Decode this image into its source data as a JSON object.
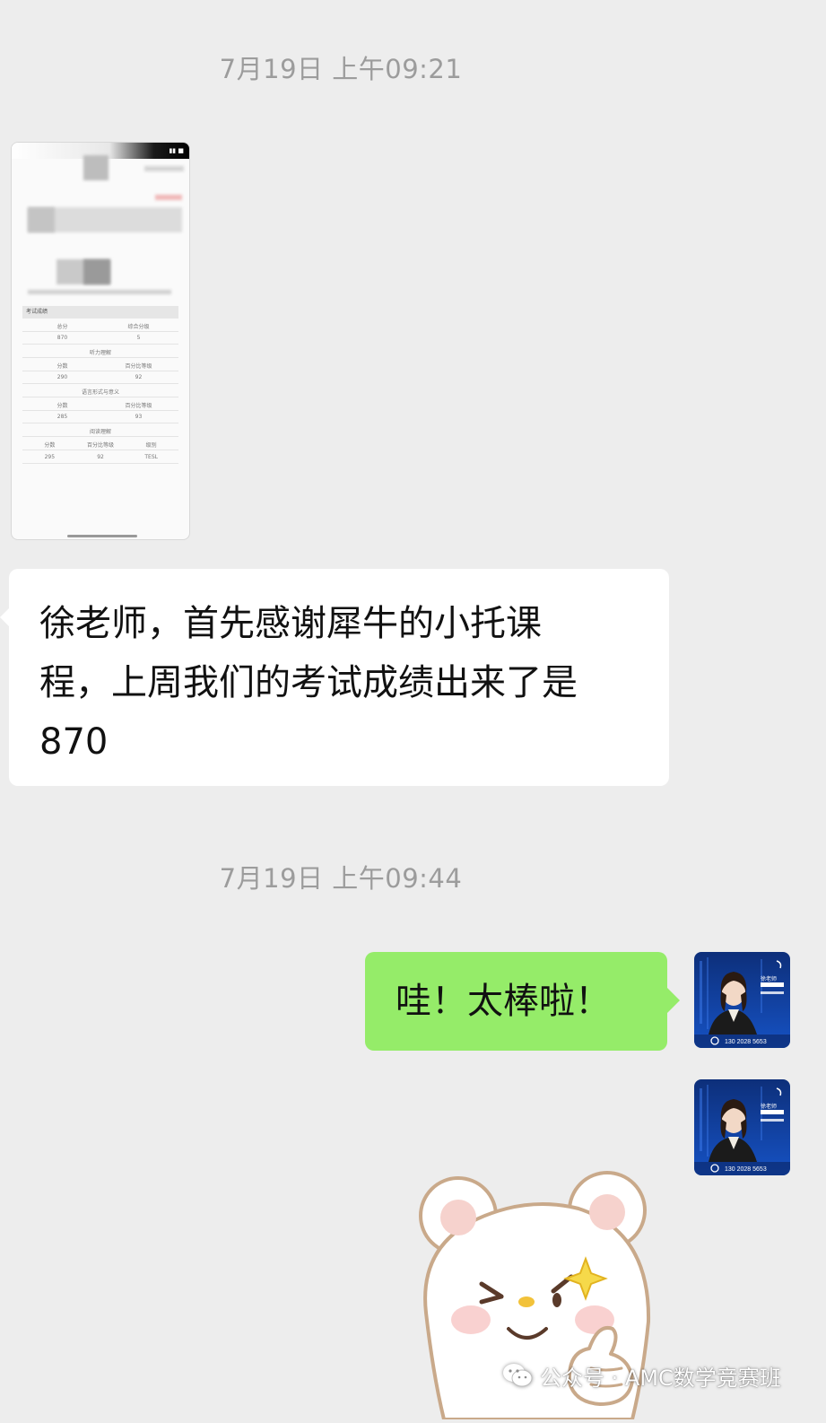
{
  "chat": {
    "timestamps": [
      "7月19日 上午09:21",
      "7月19日 上午09:44"
    ],
    "incoming_message": {
      "lines": [
        "徐老师，首先感谢犀牛的小托课",
        "程，上周我们的考试成绩出来了是",
        "870"
      ]
    },
    "outgoing_message": "哇！太棒啦！",
    "avatar": {
      "name_label": "徐老师",
      "phone": "130 2028 5653"
    }
  },
  "screenshot_thumbnail": {
    "section_header": "考试成绩",
    "rows": [
      [
        "总分",
        "综合分级"
      ],
      [
        "870",
        "5"
      ],
      [
        "听力理解"
      ],
      [
        "分数",
        "百分比等级"
      ],
      [
        "290",
        "92"
      ],
      [
        "语言形式与意义"
      ],
      [
        "分数",
        "百分比等级"
      ],
      [
        "285",
        "93"
      ],
      [
        "阅读理解"
      ],
      [
        "分数",
        "百分比等级",
        "级别"
      ],
      [
        "295",
        "92",
        "TESL"
      ]
    ]
  },
  "watermark": {
    "text": "公众号 · AMC数学竞赛班"
  },
  "colors": {
    "background": "#ededed",
    "incoming_bubble": "#ffffff",
    "outgoing_bubble": "#95ec69",
    "timestamp": "#9c9c9c"
  }
}
